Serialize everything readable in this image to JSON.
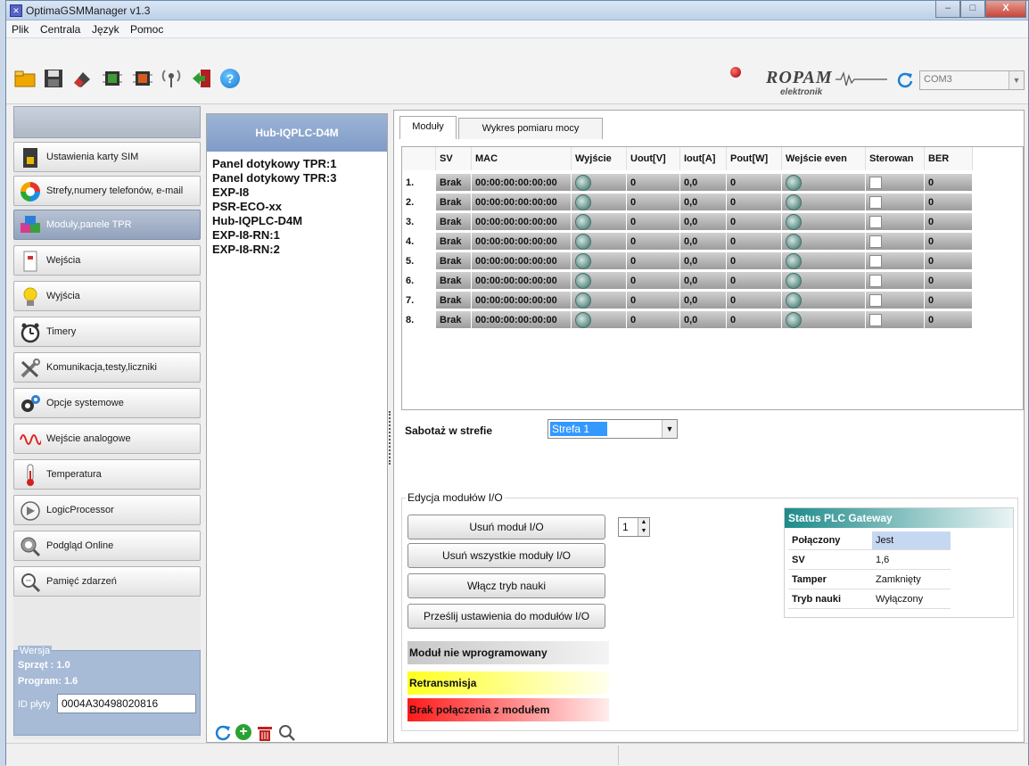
{
  "window": {
    "title": "OptimaGSMManager v1.3",
    "app_icon": "app-icon",
    "minimize": "–",
    "maximize": "□",
    "close": "X"
  },
  "menu": [
    "Plik",
    "Centrala",
    "Język",
    "Pomoc"
  ],
  "toolbar": {
    "icons": [
      "folder-icon",
      "save-icon",
      "erase-icon",
      "read-device-icon",
      "write-device-icon",
      "antenna-icon",
      "exit-icon",
      "help-icon"
    ],
    "brand": "ROPAM",
    "brand_sub": "elektronik",
    "com_port": "COM3",
    "accent": "#1a7fd6"
  },
  "sidebar": {
    "items": [
      {
        "label": "Ustawienia karty SIM",
        "icon": "sim-card-icon"
      },
      {
        "label": "Strefy,numery telefonów, e-mail",
        "icon": "zones-icon"
      },
      {
        "label": "Moduły,panele TPR",
        "icon": "modules-icon"
      },
      {
        "label": "Wejścia",
        "icon": "inputs-icon"
      },
      {
        "label": "Wyjścia",
        "icon": "bulb-icon"
      },
      {
        "label": "Timery",
        "icon": "clock-icon"
      },
      {
        "label": "Komunikacja,testy,liczniki",
        "icon": "tools-icon"
      },
      {
        "label": "Opcje systemowe",
        "icon": "gears-icon"
      },
      {
        "label": "Wejście analogowe",
        "icon": "waveform-icon"
      },
      {
        "label": "Temperatura",
        "icon": "thermometer-icon"
      },
      {
        "label": "LogicProcessor",
        "icon": "logic-icon"
      },
      {
        "label": "Podgląd Online",
        "icon": "monitor-icon"
      },
      {
        "label": "Pamięć zdarzeń",
        "icon": "events-icon"
      }
    ],
    "active_index": 2
  },
  "version": {
    "title": "Wersja",
    "hardware": "Sprzęt : 1.0",
    "program": "Program: 1.6",
    "board_id_label": "ID płyty",
    "board_id": "0004A30498020816"
  },
  "modules": {
    "header": "Hub-IQPLC-D4M",
    "list": [
      "Panel dotykowy TPR:1",
      "Panel dotykowy TPR:3",
      "EXP-I8",
      "PSR-ECO-xx",
      "Hub-IQPLC-D4M",
      "EXP-I8-RN:1",
      "EXP-I8-RN:2"
    ],
    "bottom_icons": [
      "refresh-icon",
      "add-icon",
      "delete-icon",
      "search-icon"
    ]
  },
  "tabs": [
    "Moduły",
    "Wykres pomiaru mocy"
  ],
  "grid": {
    "columns": [
      "",
      "SV",
      "MAC",
      "Wyjście",
      "Uout[V]",
      "Iout[A]",
      "Pout[W]",
      "Wejście even",
      "Sterowan",
      "BER"
    ],
    "rows": [
      {
        "n": "1.",
        "sv": "Brak",
        "mac": "00:00:00:00:00:00",
        "uout": "0",
        "iout": "0,0",
        "pout": "0",
        "ber": "0"
      },
      {
        "n": "2.",
        "sv": "Brak",
        "mac": "00:00:00:00:00:00",
        "uout": "0",
        "iout": "0,0",
        "pout": "0",
        "ber": "0"
      },
      {
        "n": "3.",
        "sv": "Brak",
        "mac": "00:00:00:00:00:00",
        "uout": "0",
        "iout": "0,0",
        "pout": "0",
        "ber": "0"
      },
      {
        "n": "4.",
        "sv": "Brak",
        "mac": "00:00:00:00:00:00",
        "uout": "0",
        "iout": "0,0",
        "pout": "0",
        "ber": "0"
      },
      {
        "n": "5.",
        "sv": "Brak",
        "mac": "00:00:00:00:00:00",
        "uout": "0",
        "iout": "0,0",
        "pout": "0",
        "ber": "0"
      },
      {
        "n": "6.",
        "sv": "Brak",
        "mac": "00:00:00:00:00:00",
        "uout": "0",
        "iout": "0,0",
        "pout": "0",
        "ber": "0"
      },
      {
        "n": "7.",
        "sv": "Brak",
        "mac": "00:00:00:00:00:00",
        "uout": "0",
        "iout": "0,0",
        "pout": "0",
        "ber": "0"
      },
      {
        "n": "8.",
        "sv": "Brak",
        "mac": "00:00:00:00:00:00",
        "uout": "0",
        "iout": "0,0",
        "pout": "0",
        "ber": "0"
      }
    ]
  },
  "sabotage": {
    "label": "Sabotaż w strefie",
    "value": "Strefa 1"
  },
  "io_edit": {
    "title": "Edycja modułów I/O",
    "remove": "Usuń moduł I/O",
    "remove_all": "Usuń wszystkie moduły I/O",
    "learn": "Włącz tryb nauki",
    "send": "Prześlij ustawienia do modułów I/O",
    "spin_value": "1"
  },
  "legend": {
    "not_programmed": "Moduł nie wprogramowany",
    "retransmission": "Retransmisja",
    "no_connection": "Brak połączenia z modułem",
    "colors": {
      "not_programmed": "#d0d0d0",
      "retransmission": "#ffff33",
      "no_connection": "#ff2222"
    }
  },
  "plc": {
    "title": "Status PLC Gateway",
    "rows": [
      {
        "key": "Połączony",
        "value": "Jest"
      },
      {
        "key": "SV",
        "value": "1,6"
      },
      {
        "key": "Tamper",
        "value": "Zamknięty"
      },
      {
        "key": "Tryb nauki",
        "value": "Wyłączony"
      }
    ]
  }
}
